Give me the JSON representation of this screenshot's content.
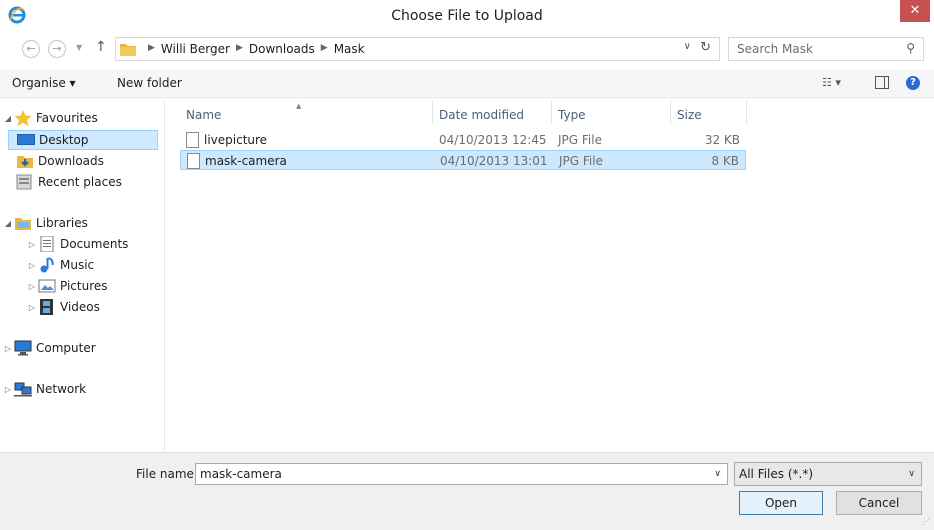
{
  "window": {
    "title": "Choose File to Upload",
    "close_label": "✕"
  },
  "address": {
    "crumbs": [
      "Willi Berger",
      "Downloads",
      "Mask"
    ],
    "search_placeholder": "Search Mask"
  },
  "toolbar": {
    "organise_label": "Organise ▾",
    "new_folder_label": "New folder"
  },
  "sidebar": {
    "favourites": {
      "label": "Favourites",
      "items": [
        {
          "label": "Desktop",
          "selected": true
        },
        {
          "label": "Downloads"
        },
        {
          "label": "Recent places"
        }
      ]
    },
    "libraries": {
      "label": "Libraries",
      "items": [
        {
          "label": "Documents"
        },
        {
          "label": "Music"
        },
        {
          "label": "Pictures"
        },
        {
          "label": "Videos"
        }
      ]
    },
    "computer_label": "Computer",
    "network_label": "Network"
  },
  "filelist": {
    "columns": {
      "name": "Name",
      "date": "Date modified",
      "type": "Type",
      "size": "Size"
    },
    "rows": [
      {
        "name": "livepicture",
        "date": "04/10/2013 12:45",
        "type": "JPG File",
        "size": "32 KB",
        "selected": false
      },
      {
        "name": "mask-camera",
        "date": "04/10/2013 13:01",
        "type": "JPG File",
        "size": "8 KB",
        "selected": true
      }
    ]
  },
  "bottom": {
    "file_name_label": "File name:",
    "file_name_value": "mask-camera",
    "filter_value": "All Files (*.*)",
    "open_label": "Open",
    "cancel_label": "Cancel"
  },
  "colors": {
    "selection": "#cce8ff",
    "selection_border": "#99d1ff",
    "close_button": "#c75050",
    "accent_blue": "#2b6cd2"
  }
}
